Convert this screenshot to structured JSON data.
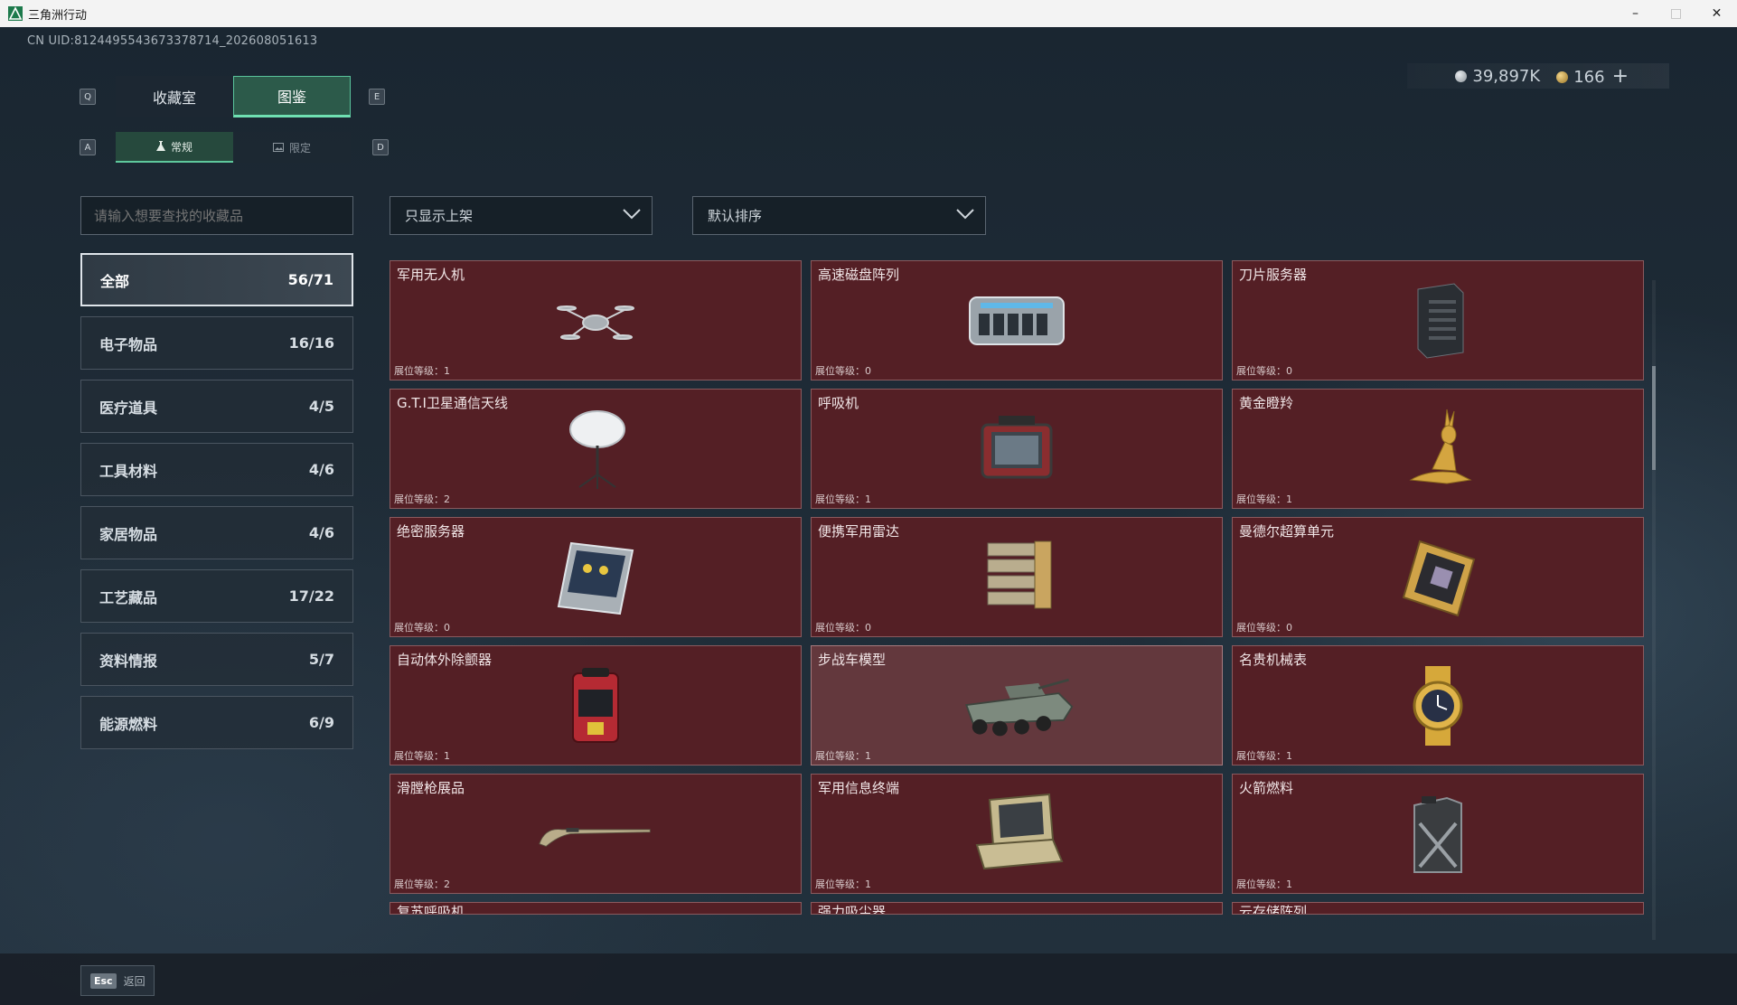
{
  "window": {
    "title": "三角洲行动",
    "minimize": "–",
    "maximize": "□",
    "close": "✕"
  },
  "uid": "CN UID:8124495543673378714_202608051613",
  "currency": {
    "silver": "39,897K",
    "gold": "166",
    "add": "+"
  },
  "hotkeys": {
    "prev_tab": "Q",
    "next_tab": "E",
    "prev_sub": "A",
    "next_sub": "D"
  },
  "main_tabs": [
    {
      "label": "收藏室",
      "active": false
    },
    {
      "label": "图鉴",
      "active": true
    }
  ],
  "sub_tabs": [
    {
      "label": "常规",
      "icon": "flask-icon",
      "active": true
    },
    {
      "label": "限定",
      "icon": "image-icon",
      "active": false
    }
  ],
  "search": {
    "placeholder": "请输入想要查找的收藏品"
  },
  "filter": {
    "selected": "只显示上架"
  },
  "sort": {
    "selected": "默认排序"
  },
  "categories": [
    {
      "label": "全部",
      "count": "56/71",
      "active": true
    },
    {
      "label": "电子物品",
      "count": "16/16"
    },
    {
      "label": "医疗道具",
      "count": "4/5"
    },
    {
      "label": "工具材料",
      "count": "4/6"
    },
    {
      "label": "家居物品",
      "count": "4/6"
    },
    {
      "label": "工艺藏品",
      "count": "17/22"
    },
    {
      "label": "资料情报",
      "count": "5/7"
    },
    {
      "label": "能源燃料",
      "count": "6/9"
    }
  ],
  "items": [
    {
      "name": "军用无人机",
      "level": "展位等级：1",
      "icon": "drone-icon"
    },
    {
      "name": "高速磁盘阵列",
      "level": "展位等级：0",
      "icon": "disk-array-icon"
    },
    {
      "name": "刀片服务器",
      "level": "展位等级：0",
      "icon": "server-tower-icon"
    },
    {
      "name": "G.T.I卫星通信天线",
      "level": "展位等级：2",
      "icon": "satellite-dish-icon"
    },
    {
      "name": "呼吸机",
      "level": "展位等级：1",
      "icon": "ventilator-icon"
    },
    {
      "name": "黄金瞪羚",
      "level": "展位等级：1",
      "icon": "gazelle-statue-icon"
    },
    {
      "name": "绝密服务器",
      "level": "展位等级：0",
      "icon": "rack-server-icon"
    },
    {
      "name": "便携军用雷达",
      "level": "展位等级：0",
      "icon": "radar-icon"
    },
    {
      "name": "曼德尔超算单元",
      "level": "展位等级：0",
      "icon": "compute-unit-icon"
    },
    {
      "name": "自动体外除颤器",
      "level": "展位等级：1",
      "icon": "defibrillator-icon"
    },
    {
      "name": "步战车模型",
      "level": "展位等级：1",
      "icon": "ifv-model-icon",
      "highlight": true
    },
    {
      "name": "名贵机械表",
      "level": "展位等级：1",
      "icon": "watch-icon"
    },
    {
      "name": "滑膛枪展品",
      "level": "展位等级：2",
      "icon": "musket-icon"
    },
    {
      "name": "军用信息终端",
      "level": "展位等级：1",
      "icon": "field-terminal-icon"
    },
    {
      "name": "火箭燃料",
      "level": "展位等级：1",
      "icon": "fuel-can-icon"
    }
  ],
  "partial_items": [
    "复苏呼吸机",
    "强力吸尘器",
    "云存储阵列"
  ],
  "footer": {
    "esc_key": "Esc",
    "back": "返回"
  },
  "colors": {
    "card_bg": "#541f25",
    "accent": "#5ec89c",
    "tab_active": "#2c5a4a"
  }
}
